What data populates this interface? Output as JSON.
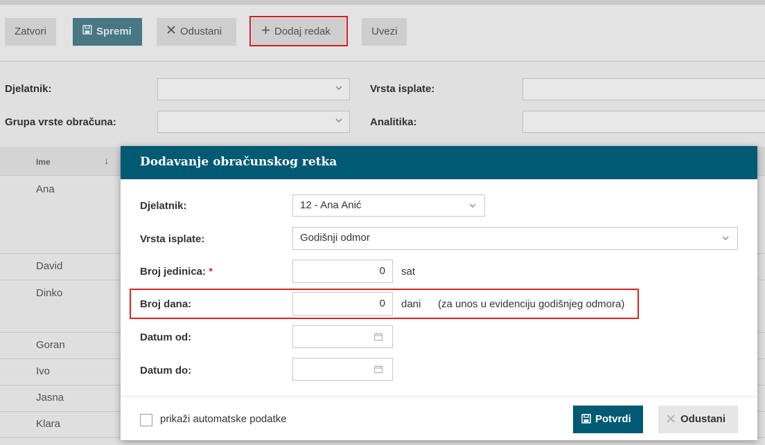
{
  "toolbar": {
    "close_label": "Zatvori",
    "save_label": "Spremi",
    "cancel_label": "Odustani",
    "add_row_label": "Dodaj redak",
    "import_label": "Uvezi"
  },
  "filters": {
    "employee_label": "Djelatnik:",
    "payment_type_label": "Vrsta isplate:",
    "calc_group_label": "Grupa vrste obračuna:",
    "analytics_label": "Analitika:"
  },
  "list": {
    "column_name": "Ime",
    "rows": [
      "Ana",
      "David",
      "Dinko",
      "Goran",
      "Ivo",
      "Jasna",
      "Klara"
    ]
  },
  "modal": {
    "title": "Dodavanje obračunskog retka",
    "employee_label": "Djelatnik:",
    "employee_value": "12 - Ana Anić",
    "payment_type_label": "Vrsta isplate:",
    "payment_type_value": "Godišnji odmor",
    "units_label": "Broj jedinica:",
    "required_mark": "*",
    "units_value": "0",
    "units_unit": "sat",
    "days_label": "Broj dana:",
    "days_value": "0",
    "days_unit": "dani",
    "days_note": "(za unos u evidenciju godišnjeg odmora)",
    "date_from_label": "Datum od:",
    "date_to_label": "Datum do:",
    "show_auto_label": "prikaži automatske podatke",
    "confirm_label": "Potvrdi",
    "cancel_label": "Odustani"
  },
  "colors": {
    "modal_header": "#005a73",
    "primary_button": "#005a73",
    "highlight": "#e02020"
  }
}
